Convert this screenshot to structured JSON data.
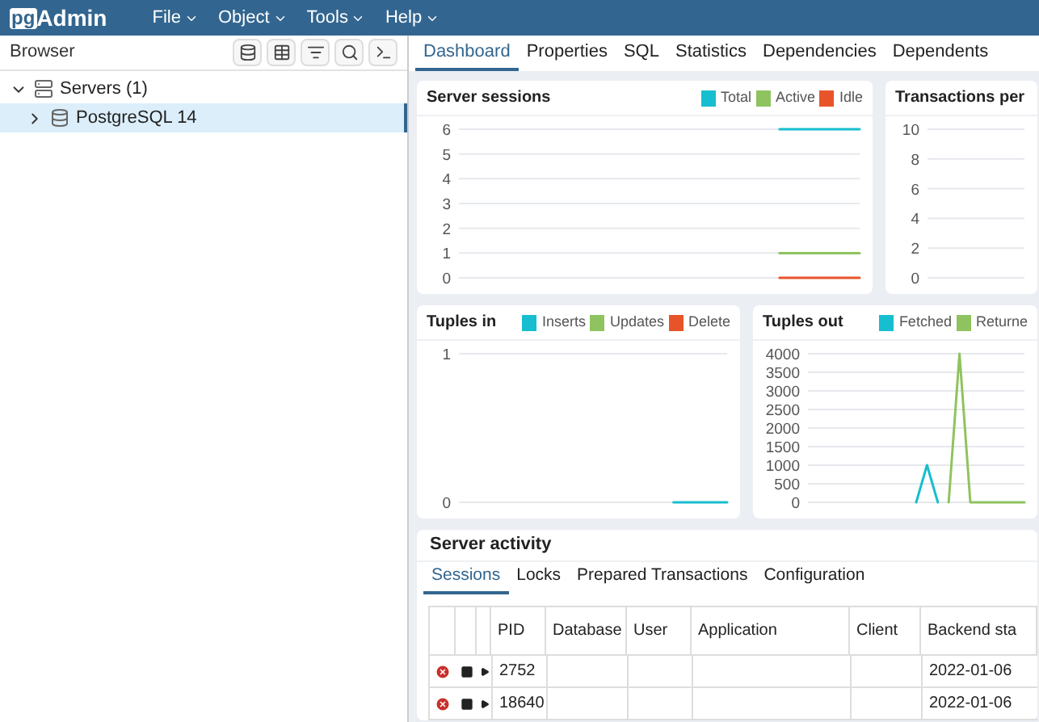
{
  "app": {
    "logo_prefix": "pg",
    "logo_name": "Admin"
  },
  "menu": [
    {
      "label": "File"
    },
    {
      "label": "Object"
    },
    {
      "label": "Tools"
    },
    {
      "label": "Help"
    }
  ],
  "browser": {
    "title": "Browser",
    "tree": [
      {
        "label": "Servers (1)",
        "kind": "group",
        "expanded": true,
        "selected": false,
        "children": [
          {
            "label": "PostgreSQL 14",
            "kind": "server",
            "expanded": false,
            "selected": true
          }
        ]
      }
    ]
  },
  "tabs": [
    {
      "label": "Dashboard",
      "selected": true
    },
    {
      "label": "Properties",
      "selected": false
    },
    {
      "label": "SQL",
      "selected": false
    },
    {
      "label": "Statistics",
      "selected": false
    },
    {
      "label": "Dependencies",
      "selected": false
    },
    {
      "label": "Dependents",
      "selected": false
    }
  ],
  "panels": [
    {
      "title": "Server sessions",
      "chart_data": {
        "type": "line",
        "grid": true,
        "categories": [
          null,
          null,
          null,
          null,
          null,
          null,
          null,
          null,
          null,
          null,
          null,
          null,
          null,
          null,
          null,
          null,
          null,
          null,
          null,
          null,
          null
        ],
        "yticks": [
          0,
          1,
          2,
          3,
          4,
          5,
          6
        ],
        "ylim": [
          0,
          6
        ],
        "series": [
          {
            "name": "Total",
            "color": "#17becf",
            "values": [
              null,
              null,
              null,
              null,
              null,
              null,
              null,
              null,
              null,
              null,
              null,
              null,
              null,
              null,
              null,
              null,
              6,
              6,
              6,
              6,
              6
            ]
          },
          {
            "name": "Active",
            "color": "#8fc35f",
            "values": [
              null,
              null,
              null,
              null,
              null,
              null,
              null,
              null,
              null,
              null,
              null,
              null,
              null,
              null,
              null,
              null,
              1,
              1,
              1,
              1,
              1
            ]
          },
          {
            "name": "Idle",
            "color": "#e8542a",
            "values": [
              null,
              null,
              null,
              null,
              null,
              null,
              null,
              null,
              null,
              null,
              null,
              null,
              null,
              null,
              null,
              null,
              0,
              0,
              0,
              0,
              0
            ]
          }
        ]
      }
    },
    {
      "title": "Transactions per",
      "chart_data": {
        "type": "line",
        "grid": true,
        "categories": [
          null,
          null,
          null,
          null,
          null,
          null,
          null,
          null,
          null,
          null,
          null,
          null,
          null,
          null,
          null,
          null,
          null,
          null,
          null,
          null,
          null
        ],
        "yticks": [
          0,
          2,
          4,
          6,
          8,
          10
        ],
        "ylim": [
          0,
          10
        ]
      }
    },
    {
      "title": "Tuples in",
      "chart_data": {
        "type": "line",
        "grid": true,
        "categories": [
          null,
          null,
          null,
          null,
          null,
          null,
          null,
          null,
          null,
          null,
          null,
          null,
          null,
          null,
          null,
          null,
          null,
          null,
          null,
          null,
          null
        ],
        "yticks": [
          0,
          1
        ],
        "ylim": [
          0,
          1
        ],
        "series": [
          {
            "name": "Inserts",
            "color": "#17becf",
            "values": [
              null,
              null,
              null,
              null,
              null,
              null,
              null,
              null,
              null,
              null,
              null,
              null,
              null,
              null,
              null,
              null,
              0,
              0,
              0,
              0,
              0
            ]
          },
          {
            "name": "Updates",
            "color": "#8fc35f",
            "values": [
              null,
              null,
              null,
              null,
              null,
              null,
              null,
              null,
              null,
              null,
              null,
              null,
              null,
              null,
              null,
              null,
              null,
              null,
              null,
              null,
              null
            ]
          },
          {
            "name": "Delete",
            "color": "#e8542a",
            "values": [
              null,
              null,
              null,
              null,
              null,
              null,
              null,
              null,
              null,
              null,
              null,
              null,
              null,
              null,
              null,
              null,
              null,
              null,
              null,
              null,
              null
            ]
          }
        ]
      }
    },
    {
      "title": "Tuples out",
      "chart_data": {
        "type": "line",
        "grid": true,
        "categories": [
          null,
          null,
          null,
          null,
          null,
          null,
          null,
          null,
          null,
          null,
          null,
          null,
          null,
          null,
          null,
          null,
          null,
          null,
          null,
          null,
          null
        ],
        "yticks": [
          0,
          500,
          1000,
          1500,
          2000,
          2500,
          3000,
          3500,
          4000
        ],
        "ylim": [
          0,
          4000
        ],
        "series": [
          {
            "name": "Fetched",
            "color": "#17becf",
            "values": [
              null,
              null,
              null,
              null,
              null,
              null,
              null,
              null,
              null,
              null,
              0,
              1000,
              0,
              null,
              null,
              null,
              null,
              null,
              null,
              null,
              null
            ]
          },
          {
            "name": "Returne",
            "color": "#8fc35f",
            "values": [
              null,
              null,
              null,
              null,
              null,
              null,
              null,
              null,
              null,
              null,
              null,
              null,
              null,
              0,
              4000,
              0,
              0,
              0,
              0,
              0,
              0
            ]
          }
        ]
      }
    }
  ],
  "activity": {
    "title": "Server activity",
    "tabs": [
      {
        "label": "Sessions",
        "selected": true
      },
      {
        "label": "Locks",
        "selected": false
      },
      {
        "label": "Prepared Transactions",
        "selected": false
      },
      {
        "label": "Configuration",
        "selected": false
      }
    ],
    "columns": [
      "PID",
      "Database",
      "User",
      "Application",
      "Client",
      "Backend sta"
    ],
    "rows": [
      {
        "pid": "2752",
        "backend_start": "2022-01-06"
      },
      {
        "pid": "18640",
        "backend_start": "2022-01-06"
      }
    ]
  }
}
